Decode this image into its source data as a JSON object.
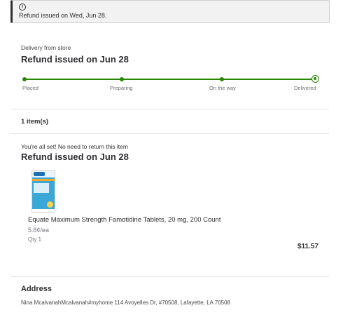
{
  "banner": {
    "icon": "info-icon",
    "icon_glyph": "i",
    "message": "Refund issued on Wed, Jun 28."
  },
  "delivery": {
    "label": "Delivery from store",
    "status_title": "Refund issued on Jun 28",
    "progress": {
      "steps": [
        "Placed",
        "Preparing",
        "On the way",
        "Delivered"
      ],
      "completed_steps": 4,
      "color": "#2a8703"
    }
  },
  "items": {
    "count_label": "1 item(s)",
    "return_note": "You're all set! No need to return this item",
    "refund_title": "Refund issued on Jun 28",
    "list": [
      {
        "name": "Equate Maximum Strength Famotidine Tablets, 20 mg, 200 Count",
        "unit_price": "5.8¢/ea",
        "qty": "Qty 1",
        "price": "$11.57"
      }
    ]
  },
  "address": {
    "title": "Address",
    "text": "Nina McalvanahMcalvanah#myhome 114 Avoyelles Dr, #70508, Lafayette, LA 70508"
  }
}
